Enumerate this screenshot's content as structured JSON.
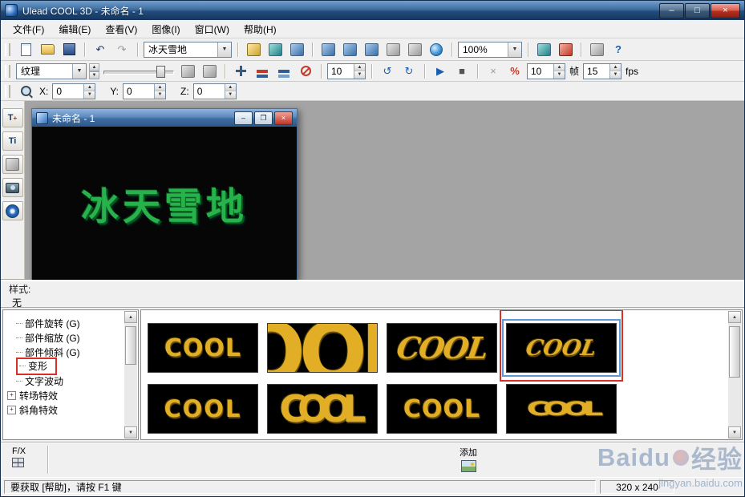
{
  "titlebar": {
    "title": "Ulead COOL 3D - 未命名 - 1"
  },
  "menubar": {
    "items": [
      {
        "label": "文件(F)"
      },
      {
        "label": "编辑(E)"
      },
      {
        "label": "查看(V)"
      },
      {
        "label": "图像(I)"
      },
      {
        "label": "窗口(W)"
      },
      {
        "label": "帮助(H)"
      }
    ]
  },
  "toolbar_standard": {
    "preset_value": "冰天雪地",
    "zoom_value": "100%"
  },
  "toolbar_animation": {
    "texture_value": "纹理",
    "division_value": "10",
    "frame_value": "10",
    "frame_unit": "帧",
    "fps_value": "15",
    "fps_unit": "fps"
  },
  "toolbar_position": {
    "x_label": "X:",
    "x_value": "0",
    "y_label": "Y:",
    "y_value": "0",
    "z_label": "Z:",
    "z_value": "0"
  },
  "document_window": {
    "title": "未命名 - 1",
    "canvas_text": "冰天雪地"
  },
  "style_panel": {
    "label": "样式:",
    "value": "无"
  },
  "effects_tree": {
    "items": [
      {
        "label": "部件旋转 (G)",
        "type": "leaf"
      },
      {
        "label": "部件缩放 (G)",
        "type": "leaf"
      },
      {
        "label": "部件倾斜 (G)",
        "type": "leaf"
      },
      {
        "label": "变形",
        "type": "leaf",
        "annotated": true
      },
      {
        "label": "文字波动",
        "type": "leaf"
      },
      {
        "label": "转场特效",
        "type": "branch"
      },
      {
        "label": "斜角特效",
        "type": "branch"
      }
    ]
  },
  "gallery": {
    "selected_index": 3,
    "thumbnails": [
      {
        "text": "COOL",
        "style": "plain"
      },
      {
        "text": "COOL",
        "style": "zoomed"
      },
      {
        "text": "COOL",
        "style": "script"
      },
      {
        "text": "COOL",
        "style": "script-small",
        "selected": true,
        "annotated": true
      },
      {
        "text": "COOL",
        "style": "plain"
      },
      {
        "text": "COOL",
        "style": "bold-overlap"
      },
      {
        "text": "COOL",
        "style": "bold"
      },
      {
        "text": "COOL",
        "style": "condensed"
      }
    ]
  },
  "fx_bar": {
    "fx_label": "F/X",
    "add_label": "添加"
  },
  "statusbar": {
    "help_text": "要获取 [帮助]，请按 F1 键",
    "size_text": "320 x 240"
  },
  "watermark": {
    "brand_left": "Baidu",
    "brand_right": "经验",
    "url": "jingyan.baidu.com"
  },
  "colors": {
    "titlebar_blue": "#2d5788",
    "canvas_text_green": "#27b24b",
    "thumb_gold": "#e2ae25",
    "annotation_red": "#d93025",
    "selection_blue": "#5b9bd5"
  },
  "icons": {
    "undo": "↶",
    "redo": "↷",
    "rotate_ccw": "↺",
    "rotate_cw": "↻",
    "play": "▶",
    "stop": "■",
    "dropdown": "▼",
    "spin_up": "▲",
    "spin_down": "▼",
    "scroll_up": "▲",
    "scroll_down": "▼",
    "minimize": "–",
    "maximize": "□",
    "restore": "❐",
    "close": "×",
    "tree_expand": "+",
    "percent": "%",
    "multiply": "×",
    "help": "?",
    "text_tool": "T",
    "text_edit": "Ti"
  }
}
